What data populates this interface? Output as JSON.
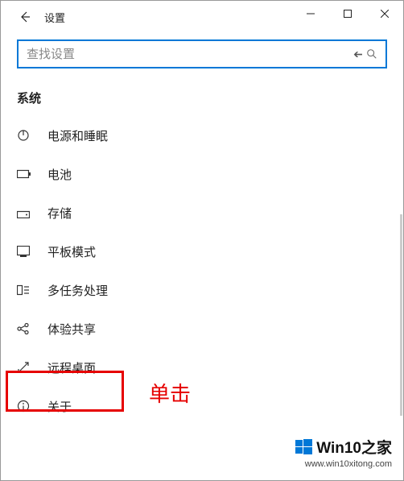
{
  "title": "设置",
  "search": {
    "placeholder": "查找设置"
  },
  "section": {
    "header": "系统"
  },
  "nav": [
    {
      "label": "电源和睡眠"
    },
    {
      "label": "电池"
    },
    {
      "label": "存储"
    },
    {
      "label": "平板模式"
    },
    {
      "label": "多任务处理"
    },
    {
      "label": "体验共享"
    },
    {
      "label": "远程桌面"
    },
    {
      "label": "关于"
    }
  ],
  "annotation": {
    "text": "单击"
  },
  "watermark": {
    "brand": "Win10之家",
    "url": "www.win10xitong.com"
  }
}
